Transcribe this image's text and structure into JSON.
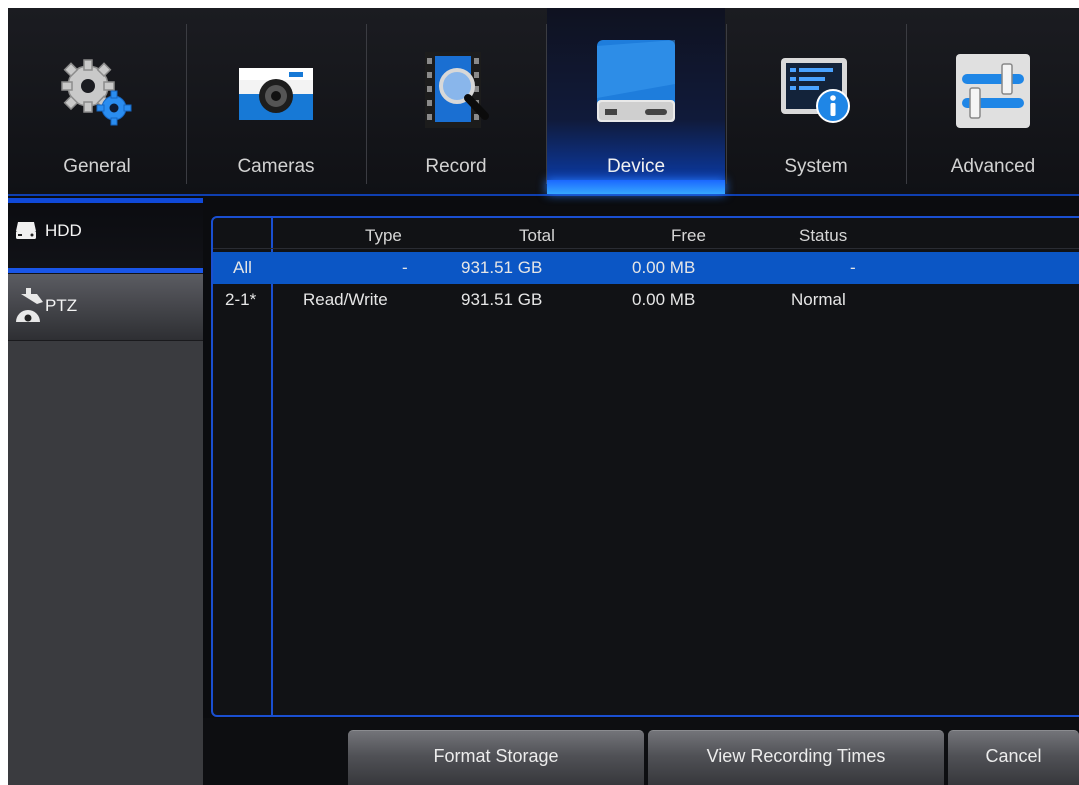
{
  "nav": {
    "tabs": [
      {
        "label": "General",
        "icon": "gears-icon"
      },
      {
        "label": "Cameras",
        "icon": "camera-icon"
      },
      {
        "label": "Record",
        "icon": "film-search-icon"
      },
      {
        "label": "Device",
        "icon": "hard-drive-icon",
        "active": true
      },
      {
        "label": "System",
        "icon": "system-info-icon"
      },
      {
        "label": "Advanced",
        "icon": "sliders-icon"
      }
    ]
  },
  "sidebar": {
    "items": [
      {
        "label": "HDD",
        "icon": "hdd-icon",
        "active": true
      },
      {
        "label": "PTZ",
        "icon": "ptz-camera-icon"
      }
    ]
  },
  "table": {
    "headers": {
      "index": "",
      "type": "Type",
      "total": "Total",
      "free": "Free",
      "status": "Status"
    },
    "rows": [
      {
        "index": "All",
        "type": "-",
        "total": "931.51 GB",
        "free": "0.00 MB",
        "status": "-",
        "selected": true
      },
      {
        "index": "2-1*",
        "type": "Read/Write",
        "total": "931.51 GB",
        "free": "0.00 MB",
        "status": "Normal"
      }
    ]
  },
  "buttons": {
    "format": "Format Storage",
    "view_times": "View Recording Times",
    "cancel": "Cancel"
  },
  "colors": {
    "accent": "#0b56c5",
    "border": "#1a4fd0",
    "background": "#0b0c0f"
  }
}
